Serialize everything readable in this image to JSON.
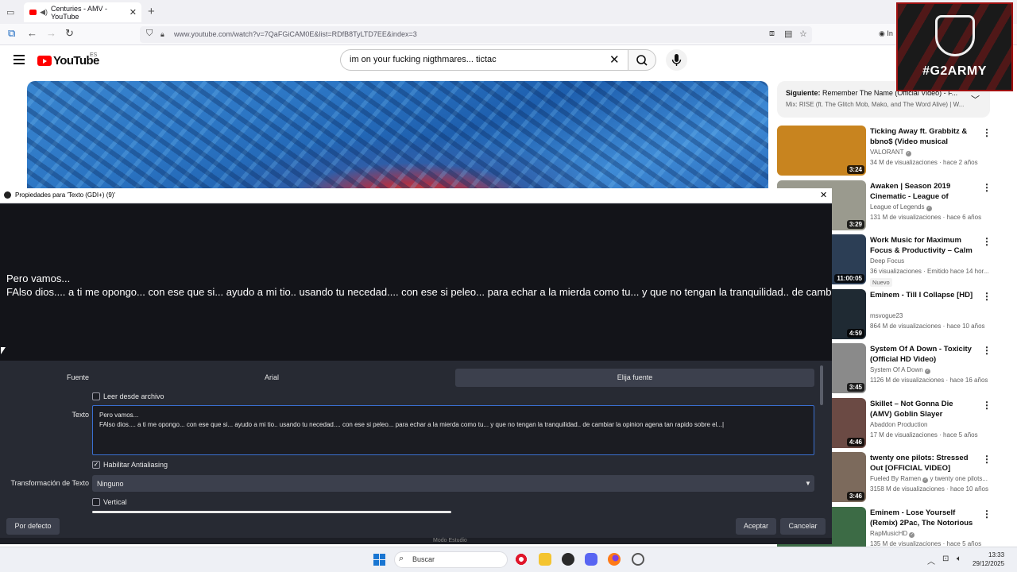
{
  "browser": {
    "tab_title": "Centuries - AMV - YouTube",
    "url": "www.youtube.com/watch?v=7QaFGiCAM0E&list=RDfB8TyLTD7EE&index=3",
    "profile_label": "In"
  },
  "youtube": {
    "logo_text": "YouTube",
    "region": "ES",
    "search_query": "im on your fucking nigthmares... tictac",
    "next": {
      "prefix": "Siguiente:",
      "title": "Remember The Name (Official Video) - F...",
      "subtitle": "Mix: RISE (ft. The Glitch Mob, Mako, and The Word Alive) | W..."
    },
    "related": [
      {
        "title": "Ticking Away ft. Grabbitz & bbno$ (Video musical oficial) /...",
        "channel": "VALORANT",
        "verified": true,
        "meta": "34 M de visualizaciones · hace 2 años",
        "duration": "3:24",
        "thumb_color": "#c8841f"
      },
      {
        "title": "Awaken | Season 2019 Cinematic - League of Legend...",
        "channel": "League of Legends",
        "verified": true,
        "meta": "131 M de visualizaciones · hace 6 años",
        "duration": "3:29",
        "thumb_color": "#9a9a8e"
      },
      {
        "title": "Work Music for Maximum Focus & Productivity – Calm ...",
        "channel": "Deep Focus",
        "verified": false,
        "meta": "36 visualizaciones · Emitido hace 14 hor...",
        "duration": "11:00:05",
        "badge": "Nuevo",
        "thumb_color": "#2c3e55"
      },
      {
        "title": "Eminem - Till I Collapse [HD]",
        "channel": "msvogue23",
        "verified": false,
        "meta": "864 M de visualizaciones · hace 10 años",
        "duration": "4:59",
        "thumb_color": "#1f2a33"
      },
      {
        "title": "System Of A Down - Toxicity (Official HD Video)",
        "channel": "System Of A Down",
        "verified": true,
        "meta": "1126 M de visualizaciones · hace 16 años",
        "duration": "3:45",
        "thumb_color": "#8a8a8a"
      },
      {
        "title": "Skillet – Not Gonna Die (AMV) Goblin Slayer",
        "channel": "Abaddon Production",
        "verified": false,
        "meta": "17 M de visualizaciones · hace 5 años",
        "duration": "4:46",
        "thumb_color": "#6b4a44"
      },
      {
        "title": "twenty one pilots: Stressed Out [OFFICIAL VIDEO]",
        "channel": "Fueled By Ramen",
        "verified": true,
        "channel_extra": "y twenty one pilots...",
        "meta": "3158 M de visualizaciones · hace 10 años",
        "duration": "3:46",
        "thumb_color": "#7c6a5c"
      },
      {
        "title": "Eminem - Lose Yourself (Remix) 2Pac, The Notorious B.I.G., ...",
        "channel": "RapMusicHD",
        "verified": true,
        "meta": "135 M de visualizaciones · hace 5 años",
        "duration": "",
        "thumb_color": "#3c6b45"
      }
    ]
  },
  "overlay": {
    "logo_text": "#G2ARMY"
  },
  "dialog": {
    "title": "Propiedades para 'Texto (GDI+) (9)'",
    "preview_lines": [
      "Pero vamos...",
      "FAlso dios.... a ti me opongo... con ese que si... ayudo a mi tio.. usando tu necedad....  con ese si peleo... para echar a la mierda como tu... y que no tengan la tranquilidad.. de cambiar la opinion agena tan rapido sobre el..."
    ],
    "font_label": "Fuente",
    "font_value": "Arial",
    "font_button": "Elija fuente",
    "read_file_label": "Leer desde archivo",
    "read_file_checked": false,
    "text_label": "Texto",
    "text_lines": [
      "Pero vamos...",
      "FAlso dios.... a ti me opongo... con ese que si... ayudo a mi tio.. usando tu necedad....  con ese si peleo... para echar a la mierda como tu... y que no tengan la tranquilidad.. de cambiar la opinion agena tan rapido sobre el...|"
    ],
    "antialias_label": "Habilitar Antialiasing",
    "antialias_checked": true,
    "transform_label": "Transformación de Texto",
    "transform_value": "Ninguno",
    "vertical_label": "Vertical",
    "vertical_checked": false,
    "defaults_button": "Por defecto",
    "accept_button": "Aceptar",
    "cancel_button": "Cancelar",
    "behind_text": "Modo Estudio"
  },
  "taskbar": {
    "search_placeholder": "Buscar",
    "time": "13:33",
    "date": "29/12/2025"
  }
}
